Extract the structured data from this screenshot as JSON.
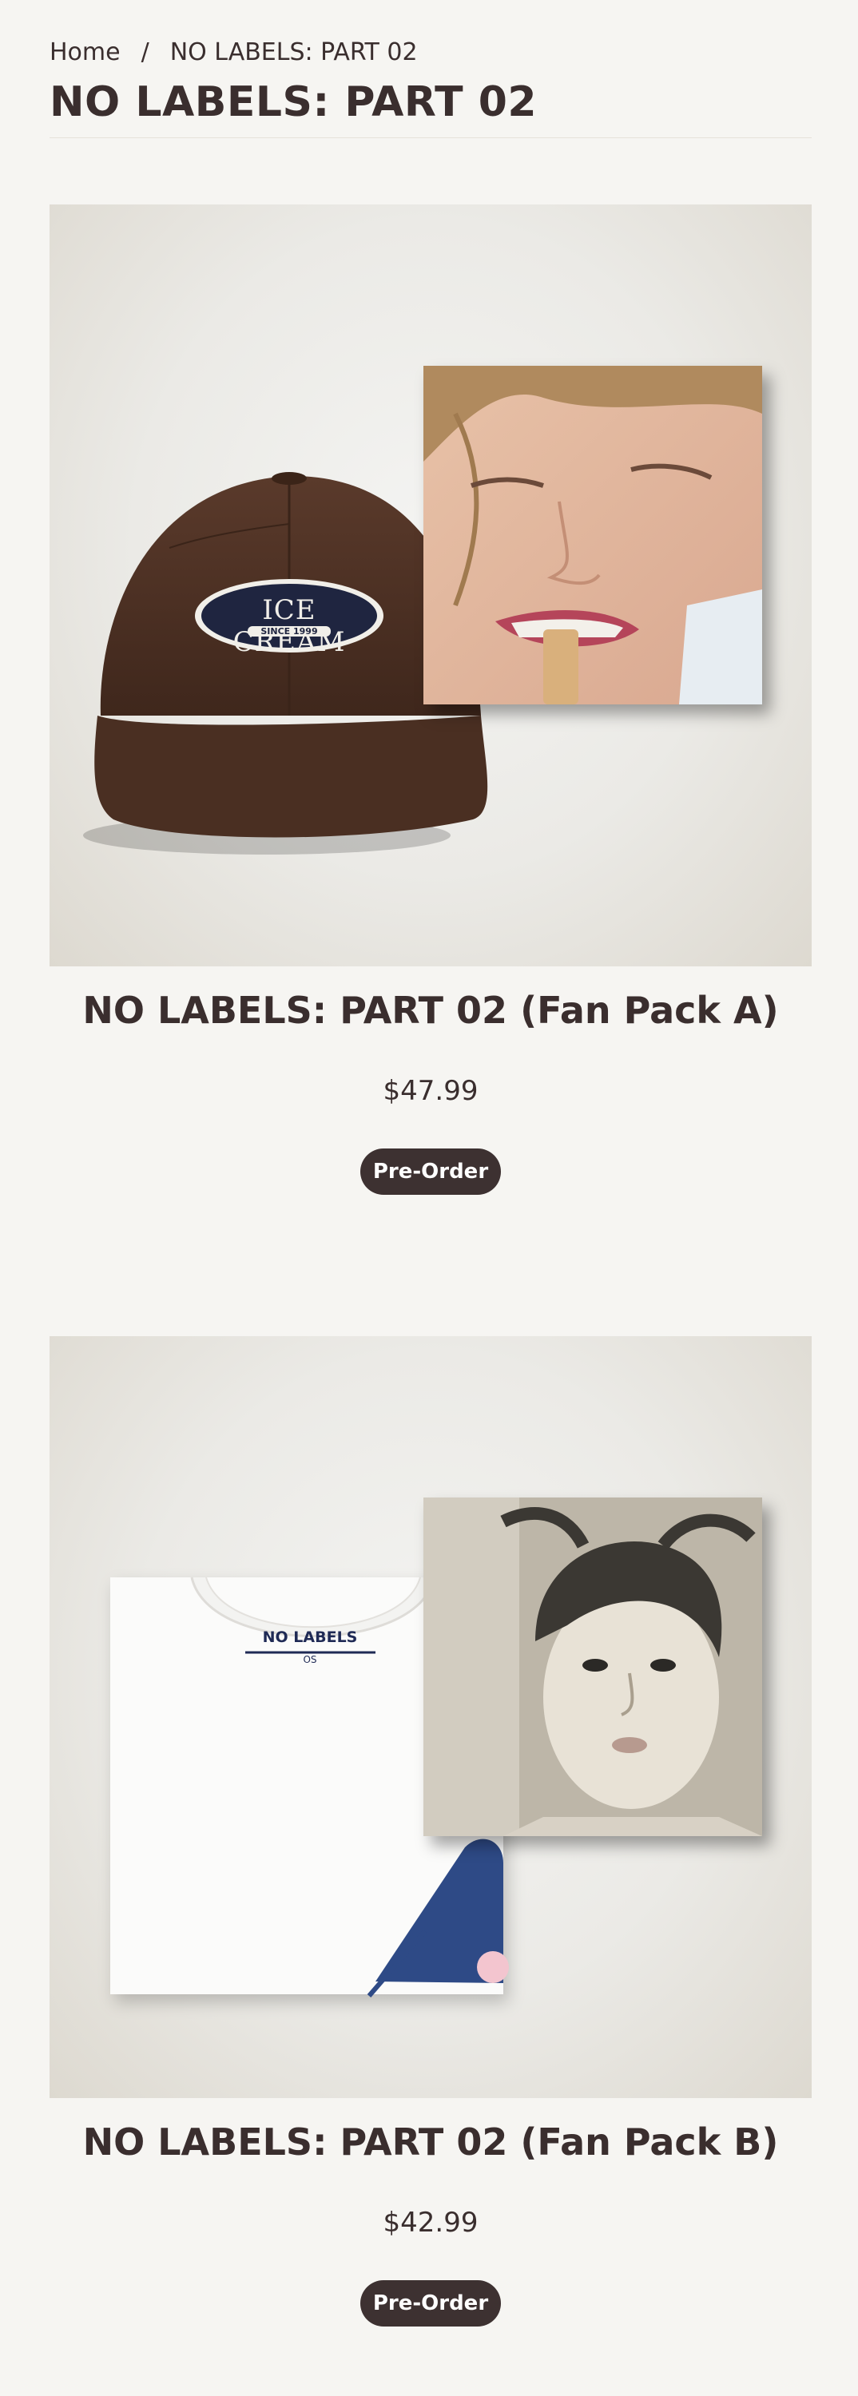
{
  "breadcrumb": {
    "home": "Home",
    "separator": "/",
    "current": "NO LABELS: PART 02"
  },
  "page_title": "NO LABELS: PART 02",
  "products": [
    {
      "title": "NO LABELS: PART 02 (Fan Pack A)",
      "price": "$47.99",
      "button": "Pre-Order",
      "cap_patch_text": "ICE CREAM",
      "cap_patch_sub": "SINCE 1999"
    },
    {
      "title": "NO LABELS: PART 02 (Fan Pack B)",
      "price": "$42.99",
      "button": "Pre-Order",
      "tee_label_text": "NO LABELS",
      "tee_size_text": "OS"
    }
  ],
  "colors": {
    "text": "#3a2e2e",
    "button_bg": "#3d3131",
    "background": "#f6f5f2"
  }
}
